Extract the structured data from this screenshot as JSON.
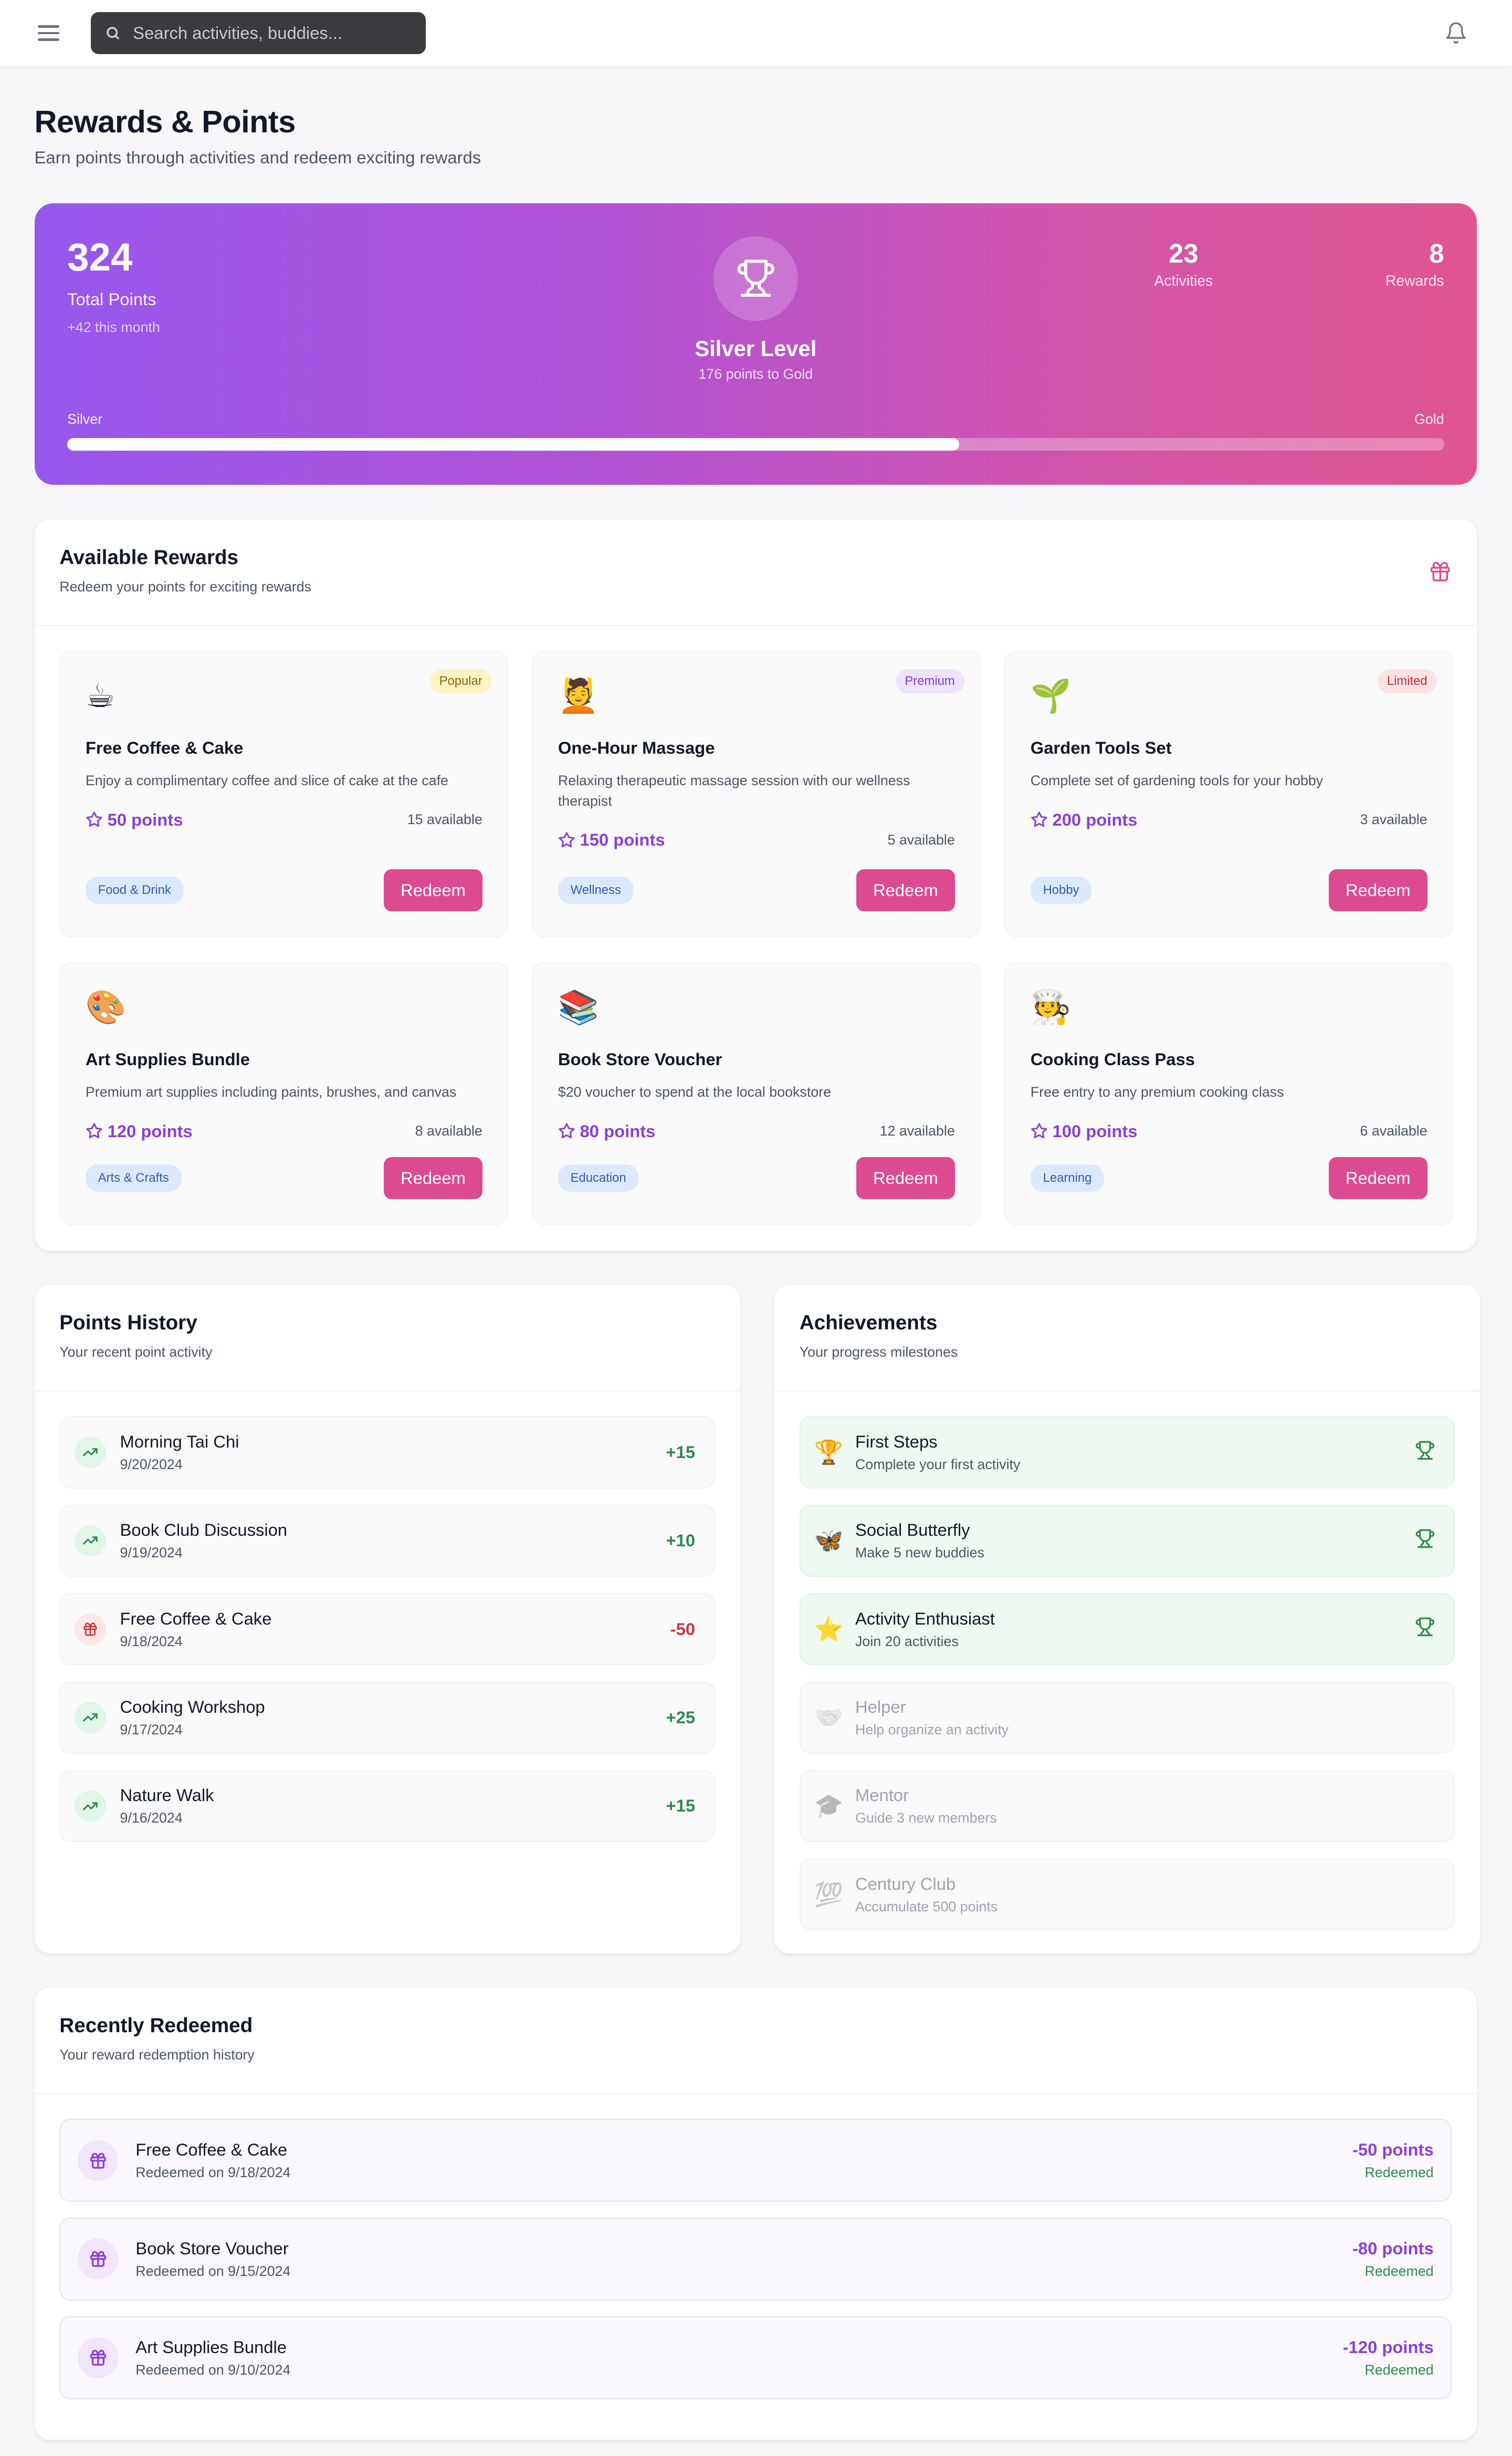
{
  "search": {
    "placeholder": "Search activities, buddies..."
  },
  "page": {
    "title": "Rewards & Points",
    "subtitle": "Earn points through activities and redeem exciting rewards"
  },
  "hero": {
    "points": "324",
    "points_label": "Total Points",
    "month": "+42 this month",
    "level": "Silver Level",
    "level_sub": "176 points to Gold",
    "activities": "23",
    "activities_label": "Activities",
    "rewards": "8",
    "rewards_label": "Rewards",
    "from": "Silver",
    "to": "Gold",
    "progress_percent": 64.8
  },
  "available": {
    "title": "Available Rewards",
    "subtitle": "Redeem your points for exciting rewards",
    "button": "Redeem",
    "items": [
      {
        "emoji": "☕",
        "badge": "Popular",
        "title": "Free Coffee & Cake",
        "desc": "Enjoy a complimentary coffee and slice of cake at the cafe",
        "points": "50 points",
        "avail": "15 available",
        "tag": "Food & Drink"
      },
      {
        "emoji": "💆",
        "badge": "Premium",
        "title": "One-Hour Massage",
        "desc": "Relaxing therapeutic massage session with our wellness therapist",
        "points": "150 points",
        "avail": "5 available",
        "tag": "Wellness"
      },
      {
        "emoji": "🌱",
        "badge": "Limited",
        "title": "Garden Tools Set",
        "desc": "Complete set of gardening tools for your hobby",
        "points": "200 points",
        "avail": "3 available",
        "tag": "Hobby"
      },
      {
        "emoji": "🎨",
        "title": "Art Supplies Bundle",
        "desc": "Premium art supplies including paints, brushes, and canvas",
        "points": "120 points",
        "avail": "8 available",
        "tag": "Arts & Crafts"
      },
      {
        "emoji": "📚",
        "title": "Book Store Voucher",
        "desc": "$20 voucher to spend at the local bookstore",
        "points": "80 points",
        "avail": "12 available",
        "tag": "Education"
      },
      {
        "emoji": "🧑‍🍳",
        "title": "Cooking Class Pass",
        "desc": "Free entry to any premium cooking class",
        "points": "100 points",
        "avail": "6 available",
        "tag": "Learning"
      }
    ]
  },
  "history": {
    "title": "Points History",
    "subtitle": "Your recent point activity",
    "items": [
      {
        "title": "Morning Tai Chi",
        "date": "9/20/2024",
        "value": "+15"
      },
      {
        "title": "Book Club Discussion",
        "date": "9/19/2024",
        "value": "+10"
      },
      {
        "title": "Free Coffee & Cake",
        "date": "9/18/2024",
        "value": "-50"
      },
      {
        "title": "Cooking Workshop",
        "date": "9/17/2024",
        "value": "+25"
      },
      {
        "title": "Nature Walk",
        "date": "9/16/2024",
        "value": "+15"
      }
    ]
  },
  "achievements": {
    "title": "Achievements",
    "subtitle": "Your progress milestones",
    "items": [
      {
        "emoji": "🏆",
        "title": "First Steps",
        "desc": "Complete your first activity"
      },
      {
        "emoji": "🦋",
        "title": "Social Butterfly",
        "desc": "Make 5 new buddies"
      },
      {
        "emoji": "⭐",
        "title": "Activity Enthusiast",
        "desc": "Join 20 activities"
      },
      {
        "emoji": "🤝",
        "title": "Helper",
        "desc": "Help organize an activity"
      },
      {
        "emoji": "🎓",
        "title": "Mentor",
        "desc": "Guide 3 new members"
      },
      {
        "emoji": "💯",
        "title": "Century Club",
        "desc": "Accumulate 500 points"
      }
    ]
  },
  "redeemed": {
    "title": "Recently Redeemed",
    "subtitle": "Your reward redemption history",
    "status": "Redeemed",
    "items": [
      {
        "title": "Free Coffee & Cake",
        "date": "Redeemed on 9/18/2024",
        "amount": "-50 points"
      },
      {
        "title": "Book Store Voucher",
        "date": "Redeemed on 9/15/2024",
        "amount": "-80 points"
      },
      {
        "title": "Art Supplies Bundle",
        "date": "Redeemed on 9/10/2024",
        "amount": "-120 points"
      }
    ]
  },
  "colors": {
    "accent": "#dc4a8f",
    "purple": "#8b3fd6",
    "positive": "#2f8a4c",
    "negative": "#c63b3b"
  }
}
